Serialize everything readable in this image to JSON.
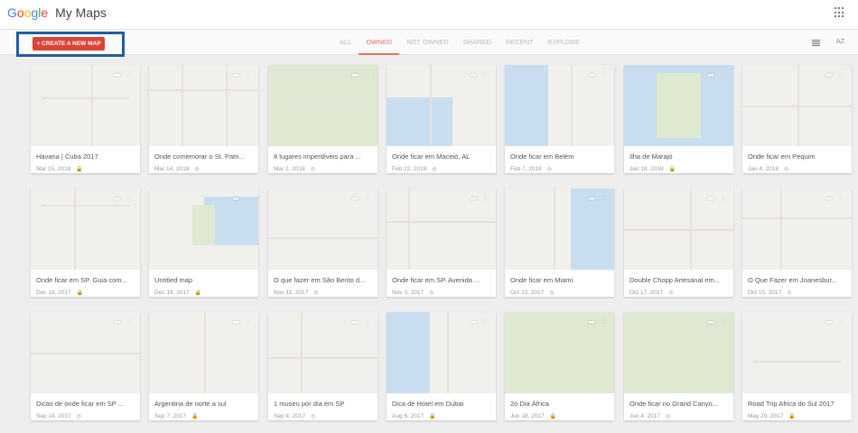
{
  "header": {
    "logo": "Google",
    "app_name": "My Maps"
  },
  "toolbar": {
    "create_label": "+ CREATE A NEW MAP",
    "tabs": [
      "ALL",
      "OWNED",
      "NOT OWNED",
      "SHARED",
      "RECENT",
      "EXPLORE"
    ],
    "active_tab": "OWNED",
    "sort_label": "AZ"
  },
  "maps": [
    {
      "title": "Havana | Cuba 2017",
      "date": "Mar 15, 2018",
      "access": "lock-icon"
    },
    {
      "title": "Onde comemorar o St. Patri...",
      "date": "Mar 14, 2018",
      "access": "globe-icon"
    },
    {
      "title": "8 lugares imperdíveis para ...",
      "date": "Mar 2, 2018",
      "access": "globe-icon"
    },
    {
      "title": "Onde ficar em Maceió, AL",
      "date": "Feb 22, 2018",
      "access": "globe-icon"
    },
    {
      "title": "Onde ficar em Belém",
      "date": "Feb 7, 2018",
      "access": "globe-icon"
    },
    {
      "title": "Ilha de Marajó",
      "date": "Jan 18, 2018",
      "access": "lock-icon"
    },
    {
      "title": "Onde ficar em Pequim",
      "date": "Jan 4, 2018",
      "access": "globe-icon"
    },
    {
      "title": "Onde ficar em SP. Guia com...",
      "date": "Dec 18, 2017",
      "access": "lock-icon"
    },
    {
      "title": "Untitled map",
      "date": "Dec 18, 2017",
      "access": "lock-icon"
    },
    {
      "title": "O que fazer em São Bento d...",
      "date": "Nov 11, 2017",
      "access": "globe-icon"
    },
    {
      "title": "Onde ficar em SP. Avenida ...",
      "date": "Nov 3, 2017",
      "access": "globe-icon"
    },
    {
      "title": "Onde ficar em Miami",
      "date": "Oct 23, 2017",
      "access": "globe-icon"
    },
    {
      "title": "Double Chopp Artesanal em...",
      "date": "Oct 17, 2017",
      "access": "globe-icon"
    },
    {
      "title": "O Que Fazer em Joanesbur...",
      "date": "Oct 15, 2017",
      "access": "globe-icon"
    },
    {
      "title": "Dicas de onde ficar em SP ...",
      "date": "Sep 14, 2017",
      "access": "globe-icon"
    },
    {
      "title": "Argentina de norte a sul",
      "date": "Sep 7, 2017",
      "access": "lock-icon"
    },
    {
      "title": "1 museu por dia em SP",
      "date": "Sep 4, 2017",
      "access": "globe-icon"
    },
    {
      "title": "Dica de Hotel em Dubai",
      "date": "Aug 6, 2017",
      "access": "lock-icon"
    },
    {
      "title": "2o Dia África",
      "date": "Jun 18, 2017",
      "access": "lock-icon"
    },
    {
      "title": "Onde ficar no Grand Canyo...",
      "date": "Jun 4, 2017",
      "access": "globe-icon"
    },
    {
      "title": "Road Trip Africa do Sul 2017",
      "date": "May 29, 2017",
      "access": "lock-icon"
    }
  ],
  "colors": {
    "accent": "#db4437",
    "highlight_border": "#1f5fa0",
    "active_tab": "#e57368"
  }
}
